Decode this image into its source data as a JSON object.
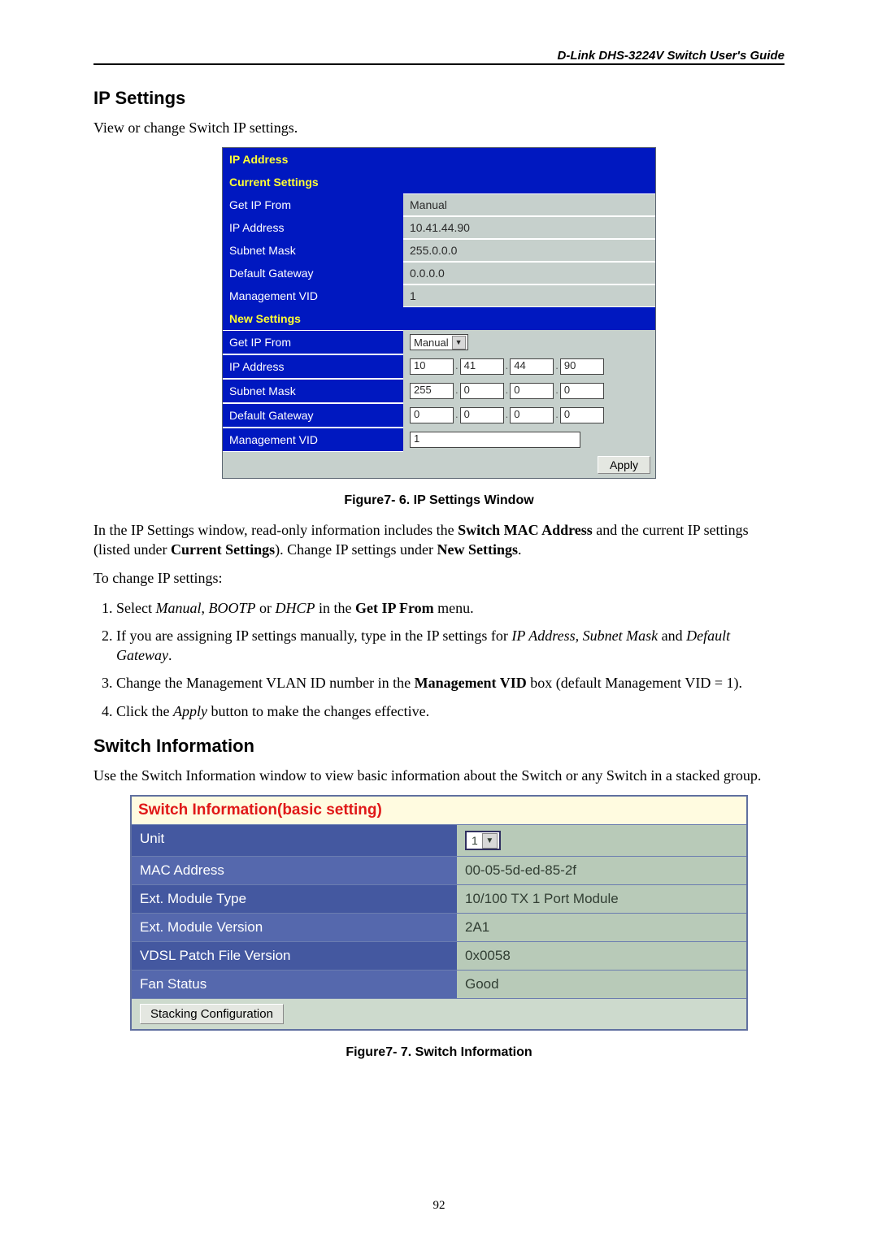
{
  "header": {
    "title": "D-Link DHS-3224V Switch User's Guide"
  },
  "ip_section": {
    "heading": "IP Settings",
    "intro": "View or change Switch IP settings.",
    "panel": {
      "title": "IP Address",
      "current_hdr": "Current Settings",
      "current": {
        "get_ip_from_lbl": "Get IP From",
        "get_ip_from_val": "Manual",
        "ip_lbl": "IP Address",
        "ip_val": "10.41.44.90",
        "mask_lbl": "Subnet Mask",
        "mask_val": "255.0.0.0",
        "gw_lbl": "Default Gateway",
        "gw_val": "0.0.0.0",
        "vid_lbl": "Management VID",
        "vid_val": "1"
      },
      "new_hdr": "New Settings",
      "new": {
        "get_ip_from_lbl": "Get IP From",
        "get_ip_from_val": "Manual",
        "ip_lbl": "IP Address",
        "ip_oct": [
          "10",
          "41",
          "44",
          "90"
        ],
        "mask_lbl": "Subnet Mask",
        "mask_oct": [
          "255",
          "0",
          "0",
          "0"
        ],
        "gw_lbl": "Default Gateway",
        "gw_oct": [
          "0",
          "0",
          "0",
          "0"
        ],
        "vid_lbl": "Management VID",
        "vid_val": "1"
      },
      "apply": "Apply"
    },
    "figcap": "Figure7- 6.  IP Settings Window",
    "para1_a": "In the IP Settings window, read-only information includes the ",
    "para1_b": "Switch MAC Address",
    "para1_c": " and the current IP settings (listed under ",
    "para1_d": "Current Settings",
    "para1_e": "). Change IP settings under ",
    "para1_f": "New Settings",
    "para1_g": ".",
    "para2": "To change IP settings:",
    "steps": {
      "s1a": "Select ",
      "s1b": "Manual",
      "s1c": ", ",
      "s1d": "BOOTP",
      "s1e": " or ",
      "s1f": "DHCP",
      "s1g": " in the ",
      "s1h": "Get IP From",
      "s1i": " menu.",
      "s2a": "If you are assigning IP settings manually, type in the IP settings for ",
      "s2b": "IP Address",
      "s2c": ", ",
      "s2d": "Subnet Mask",
      "s2e": " and ",
      "s2f": "Default Gateway",
      "s2g": ".",
      "s3a": "Change the Management VLAN ID number in the ",
      "s3b": "Management VID",
      "s3c": " box (default Management VID = 1).",
      "s4a": "Click the ",
      "s4b": "Apply",
      "s4c": " button to make the changes effective."
    }
  },
  "sw_section": {
    "heading": "Switch Information",
    "intro": "Use the Switch Information window to view basic information about the Switch or any Switch in a stacked group.",
    "panel": {
      "title": "Switch Information(basic setting)",
      "rows": {
        "unit_lbl": "Unit",
        "unit_val": "1",
        "mac_lbl": "MAC Address",
        "mac_val": "00-05-5d-ed-85-2f",
        "modtype_lbl": "Ext. Module Type",
        "modtype_val": "10/100 TX 1 Port Module",
        "modver_lbl": "Ext. Module Version",
        "modver_val": "2A1",
        "vdsl_lbl": "VDSL Patch File Version",
        "vdsl_val": "0x0058",
        "fan_lbl": "Fan Status",
        "fan_val": "Good"
      },
      "stack_btn": "Stacking Configuration"
    },
    "figcap": "Figure7- 7. Switch Information"
  },
  "page_number": "92"
}
